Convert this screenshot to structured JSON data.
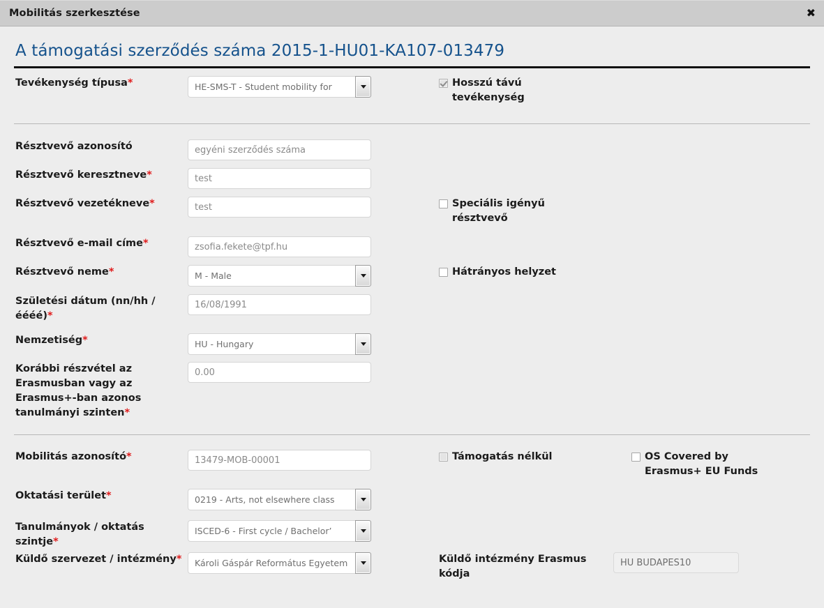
{
  "window": {
    "title": "Mobilitás szerkesztése",
    "close_icon": "close-icon",
    "close_glyph": "✖"
  },
  "form": {
    "heading": "A támogatási szerződés száma 2015-1-HU01-KA107-013479",
    "accent_color": "#15528c",
    "required_marker": "*",
    "section1": {
      "activity_type": {
        "label": "Tevékenység típusa",
        "required": true,
        "control": "select",
        "value": "HE-SMS-T - Student mobility for"
      },
      "long_term": {
        "label": "Hosszú távú tevékenység",
        "control": "checkbox",
        "checked": true,
        "disabled": true
      }
    },
    "section2": {
      "participant_id": {
        "label": "Résztvevő azonosító",
        "required": false,
        "control": "text",
        "value": "",
        "placeholder": "egyéni szerződés száma"
      },
      "first_name": {
        "label": "Résztvevő keresztneve",
        "required": true,
        "control": "text",
        "value": "test"
      },
      "last_name": {
        "label": "Résztvevő vezetékneve",
        "required": true,
        "control": "text",
        "value": "test"
      },
      "email": {
        "label": "Résztvevő e-mail címe",
        "required": true,
        "control": "text",
        "value": "zsofia.fekete@tpf.hu"
      },
      "gender": {
        "label": "Résztvevő neme",
        "required": true,
        "control": "select",
        "value": "M - Male"
      },
      "birth_date": {
        "label": "Születési dátum (nn/hh /éééé)",
        "required": true,
        "control": "text",
        "value": "16/08/1991"
      },
      "nationality": {
        "label": "Nemzetiség",
        "required": true,
        "control": "select",
        "value": "HU - Hungary"
      },
      "previous_participation": {
        "label": "Korábbi részvétel az Erasmusban vagy az Erasmus+-ban azonos tanulmányi szinten",
        "required": true,
        "control": "text",
        "value": "0.00"
      },
      "special_needs": {
        "label": "Speciális igényű résztvevő",
        "control": "checkbox",
        "checked": false,
        "disabled": false
      },
      "disadvantaged": {
        "label": "Hátrányos helyzet",
        "control": "checkbox",
        "checked": false,
        "disabled": false
      }
    },
    "section3": {
      "mobility_id": {
        "label": "Mobilitás azonosító",
        "required": true,
        "control": "text",
        "value": "13479-MOB-00001"
      },
      "no_grant": {
        "label": "Támogatás nélkül",
        "control": "checkbox",
        "checked": false,
        "disabled": true
      },
      "os_covered": {
        "label": "OS Covered by Erasmus+ EU Funds",
        "control": "checkbox",
        "checked": false,
        "disabled": false
      },
      "field_of_education": {
        "label": "Oktatási terület",
        "required": true,
        "control": "select",
        "value": "0219 - Arts, not elsewhere class"
      },
      "study_level": {
        "label": "Tanulmányok / oktatás szintje",
        "required": true,
        "control": "select",
        "value": "ISCED-6 - First cycle / Bachelor’"
      },
      "sending_org": {
        "label": "Küldő szervezet / intézmény",
        "required": true,
        "control": "select",
        "value": "Károli Gáspár Református Egyetem"
      },
      "sending_erasmus_code": {
        "label": "Küldő intézmény Erasmus kódja",
        "required": false,
        "control": "text",
        "value": "HU BUDAPES10",
        "readonly": true
      }
    }
  }
}
